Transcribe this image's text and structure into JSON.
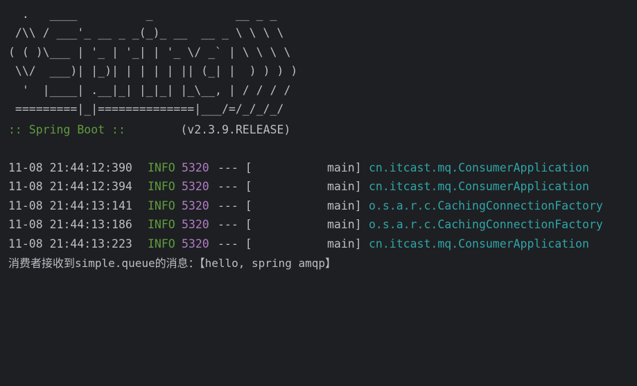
{
  "banner": {
    "ascii_art": "  .   ____          _            __ _ _\n /\\\\ / ___'_ __ _ _(_)_ __  __ _ \\ \\ \\ \\\n( ( )\\___ | '_ | '_| | '_ \\/ _` | \\ \\ \\ \\\n \\\\/  ___)| |_)| | | | | || (_| |  ) ) ) )\n  '  |____| .__|_| |_|_| |_\\__, | / / / /\n =========|_|==============|___/=/_/_/_/",
    "name": ":: Spring Boot ::",
    "version": "(v2.3.9.RELEASE)"
  },
  "logs": [
    {
      "timestamp": "11-08 21:44:12:390",
      "level": "INFO",
      "pid": "5320",
      "separator": "--- [",
      "thread": "main]",
      "logger": "cn.itcast.mq.ConsumerApplication"
    },
    {
      "timestamp": "11-08 21:44:12:394",
      "level": "INFO",
      "pid": "5320",
      "separator": "--- [",
      "thread": "main]",
      "logger": "cn.itcast.mq.ConsumerApplication"
    },
    {
      "timestamp": "11-08 21:44:13:141",
      "level": "INFO",
      "pid": "5320",
      "separator": "--- [",
      "thread": "main]",
      "logger": "o.s.a.r.c.CachingConnectionFactory"
    },
    {
      "timestamp": "11-08 21:44:13:186",
      "level": "INFO",
      "pid": "5320",
      "separator": "--- [",
      "thread": "main]",
      "logger": "o.s.a.r.c.CachingConnectionFactory"
    },
    {
      "timestamp": "11-08 21:44:13:223",
      "level": "INFO",
      "pid": "5320",
      "separator": "--- [",
      "thread": "main]",
      "logger": "cn.itcast.mq.ConsumerApplication"
    }
  ],
  "message": "消费者接收到simple.queue的消息：【hello, spring amqp】",
  "colors": {
    "background": "#1e1f22",
    "text": "#bcbec4",
    "level_info": "#5f9c3f",
    "pid": "#b07cc6",
    "logger": "#2fa5a8"
  }
}
